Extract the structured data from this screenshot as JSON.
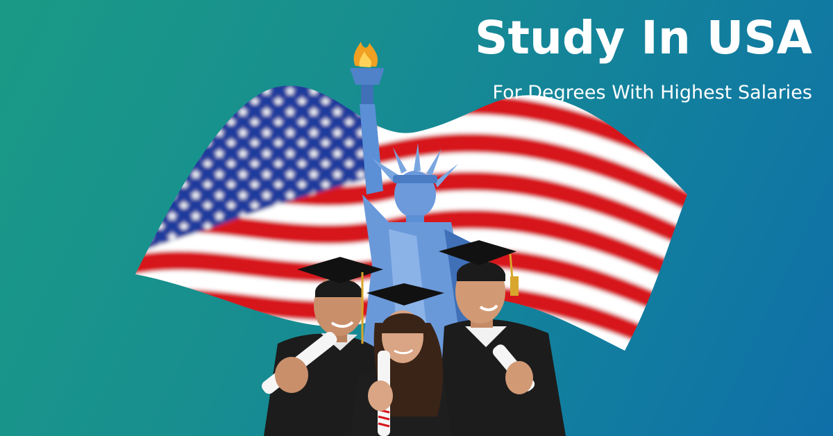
{
  "banner": {
    "title": "Study In USA",
    "subtitle": "For Degrees With Highest Salaries"
  },
  "colors": {
    "background_start": "#1a9a86",
    "background_end": "#0f6fa8",
    "flag_red": "#d7141e",
    "flag_blue": "#1a3a9c",
    "statue_blue": "#5b8fd6",
    "gown_black": "#1c1c1c",
    "text": "#ffffff"
  },
  "illustration": {
    "flag": "american-flag",
    "statue": "statue-of-liberty",
    "people": [
      "graduate-left",
      "graduate-center",
      "graduate-right"
    ]
  }
}
